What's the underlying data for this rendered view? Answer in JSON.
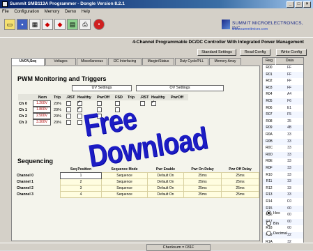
{
  "window": {
    "title": "Summit SMB113A Programmer - Dongle Version 8.2.1"
  },
  "menu": [
    "File",
    "Configuration",
    "Memory",
    "Demo",
    "Help"
  ],
  "company": {
    "name": "SUMMIT MICROELECTRONICS, INC.",
    "url": "www.summitmicro.com"
  },
  "heading": "4-Channel Programmable DC/DC Controller With Integrated Power Management",
  "buttons": {
    "standard": "Standard Settings",
    "read": "Read Config",
    "write": "Write Config"
  },
  "tabs": [
    "UVOV,Seq",
    "Voltages",
    "Miscellaneous",
    "I2C Interfacing",
    "Margin/Status",
    "Duty Cycle/PLL",
    "Memory Array"
  ],
  "pwm": {
    "title": "PWM Monitoring and Triggers",
    "uv_label": "UV Settings",
    "ov_label": "OV Settings",
    "cols": [
      "Nom",
      "Trip",
      ".RST",
      "Healthy",
      "PwrOff",
      "FSD",
      "Trip",
      ".RST",
      "Healthy",
      "PwrOff"
    ],
    "rows": [
      {
        "ch": "Ch 0",
        "nom": "1.200V",
        "trip": "20%",
        "healthy": true
      },
      {
        "ch": "Ch 1",
        "nom": "1.800V",
        "trip": "20%",
        "healthy": true
      },
      {
        "ch": "Ch 2",
        "nom": "2.500V",
        "trip": "20%",
        "healthy": false
      },
      {
        "ch": "Ch 3",
        "nom": "3.300V",
        "trip": "20%",
        "healthy": false
      }
    ]
  },
  "sequencing": {
    "title": "Sequencing",
    "cols": [
      "Seq Position",
      "Sequence Mode",
      "Pwr Enable",
      "Pwr On Delay",
      "Pwr Off Delay"
    ],
    "rows": [
      {
        "name": "Channel 0",
        "pos": "1",
        "mode": "Sequence",
        "enable": "Default On",
        "on": "25ms",
        "off": "25ms"
      },
      {
        "name": "Channel 1",
        "pos": "2",
        "mode": "Sequence",
        "enable": "Default On",
        "on": "25ms",
        "off": "25ms"
      },
      {
        "name": "Channel 2",
        "pos": "3",
        "mode": "Sequence",
        "enable": "Default On",
        "on": "25ms",
        "off": "25ms"
      },
      {
        "name": "Channel 3",
        "pos": "4",
        "mode": "Sequence",
        "enable": "Default On",
        "on": "25ms",
        "off": "25ms"
      }
    ]
  },
  "regs": {
    "headers": [
      "Reg",
      "Data"
    ],
    "rows": [
      [
        "R00",
        "FF"
      ],
      [
        "R01",
        "FF"
      ],
      [
        "R02",
        "FF"
      ],
      [
        "R03",
        "FF"
      ],
      [
        "R04",
        "A4"
      ],
      [
        "R05",
        "F6"
      ],
      [
        "R06",
        "E1"
      ],
      [
        "R07",
        "F5"
      ],
      [
        "R08",
        "25"
      ],
      [
        "R09",
        "4B"
      ],
      [
        "R0A",
        "33"
      ],
      [
        "R0B",
        "33"
      ],
      [
        "R0C",
        "33"
      ],
      [
        "R0D",
        "33"
      ],
      [
        "R0E",
        "33"
      ],
      [
        "R0F",
        "33"
      ],
      [
        "R10",
        "33"
      ],
      [
        "R11",
        "33"
      ],
      [
        "R12",
        "33"
      ],
      [
        "R13",
        "33"
      ],
      [
        "R14",
        "C0"
      ],
      [
        "R15",
        "00"
      ],
      [
        "R16",
        "00"
      ],
      [
        "R17",
        "00"
      ],
      [
        "R18",
        "00"
      ],
      [
        "R19",
        "22"
      ],
      [
        "R1A",
        "32"
      ]
    ]
  },
  "radix": {
    "options": [
      "Hex",
      "Bin",
      "Decimal"
    ],
    "selected": "Hex"
  },
  "status": {
    "checksum": "Checksum = 031F"
  },
  "watermark": "Free Download"
}
